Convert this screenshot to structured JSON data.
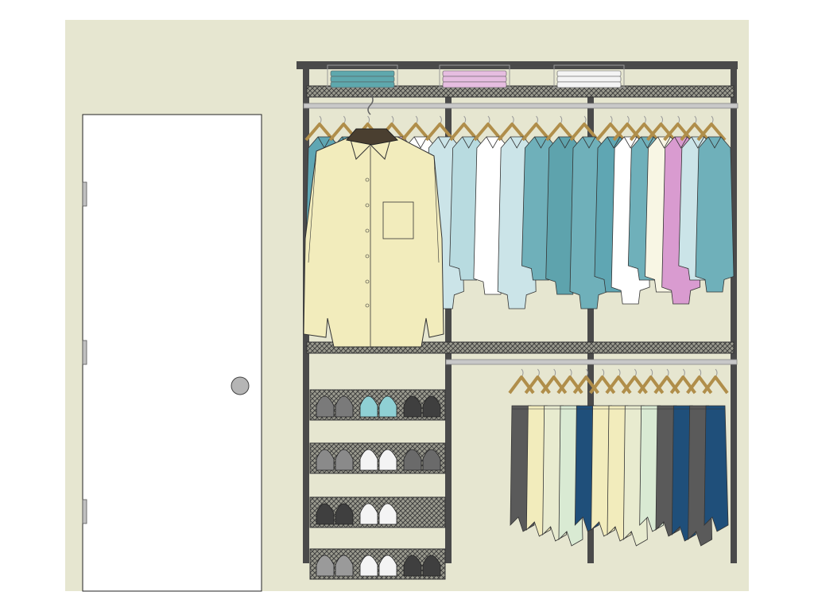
{
  "scene": {
    "wall_color": "#e6e6d0",
    "frame_color": "#4a4a4a",
    "rod_color": "#c8c8c8",
    "hanger_color": "#b08e4a",
    "door_color": "#ffffff",
    "door_knob_color": "#b5b5b5",
    "door_hinge_color": "#c0c0c0",
    "shelf_color": "#555555"
  },
  "icons": {
    "door": "door-icon",
    "shoe": "shoe-icon",
    "hanger": "hanger-icon",
    "shirt": "shirt-icon",
    "pants": "pants-icon",
    "folded_stack": "folded-clothes-icon"
  },
  "closet": {
    "top_stacks": [
      {
        "name": "teal-folded-stack",
        "color": "#5ea8ad"
      },
      {
        "name": "pink-folded-stack",
        "color": "#e6bde0"
      },
      {
        "name": "white-folded-stack",
        "color": "#f4f4f4"
      }
    ],
    "featured_shirt": {
      "color": "#f2ecbc",
      "hanger_color": "#4a3f30"
    },
    "upper_left_garments": [
      "#5fa6b3",
      "#5fa6b3",
      "#e0b2dc",
      "#e6bde0",
      "#ffffff",
      "#cbe4e8",
      "#b8dbe0",
      "#ffffff",
      "#cbe4e8",
      "#6fb0ba",
      "#5ea3ad",
      "#6fb0ba"
    ],
    "upper_right_garments": [
      "#5fa6b3",
      "#ffffff",
      "#6fb0ba",
      "#f8f6e4",
      "#d99bd0",
      "#cbe4e8",
      "#6fb0ba"
    ],
    "shoe_racks": [
      {
        "pairs": [
          "#7a7a7a",
          "#8fd0d4",
          "#3f3f3f"
        ]
      },
      {
        "pairs": [
          "#8a8a8a",
          "#f4f4f4",
          "#6a6a6a"
        ]
      },
      {
        "pairs": [
          "#3f3f3f",
          "#f4f4f4"
        ]
      },
      {
        "pairs": [
          "#9a9a9a",
          "#f4f4f4",
          "#3f3f3f"
        ]
      }
    ],
    "pants_colors": [
      "#5a5a5a",
      "#f2ecbc",
      "#e8ebcf",
      "#d9ead3",
      "#1f4f7a",
      "#f2ecbc",
      "#f2ecbc",
      "#e8ebcf",
      "#d9ead3",
      "#5a5a5a",
      "#1f4f7a",
      "#5a5a5a",
      "#1f4f7a"
    ]
  }
}
